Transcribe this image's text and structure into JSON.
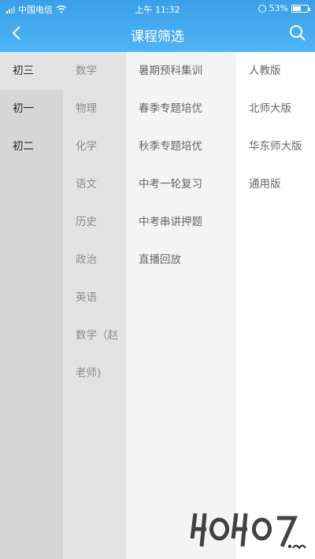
{
  "status_bar": {
    "carrier": "中国电信",
    "time": "上午 11:32",
    "battery": "53%",
    "battery_level": 0.53
  },
  "header": {
    "title": "课程筛选",
    "back_icon": "chevron-left-icon",
    "search_icon": "search-icon"
  },
  "colors": {
    "header": "#4aaef2",
    "col1": "#d6d6d6",
    "col2": "#e3e3e3",
    "col3": "#f4f4f4",
    "col4": "#ffffff"
  },
  "grades": {
    "selected": "初三",
    "items": [
      "初三",
      "初一",
      "初二"
    ]
  },
  "subjects": [
    "数学",
    "物理",
    "化学",
    "语文",
    "历史",
    "政治",
    "英语",
    "数学（赵",
    "老师)"
  ],
  "courses": [
    "暑期预科集训",
    "春季专题培优",
    "秋季专题培优",
    "中考一轮复习",
    "中考串讲押题",
    "直播回放"
  ],
  "editions": [
    "人教版",
    "北师大版",
    "华东师大版",
    "通用版"
  ]
}
